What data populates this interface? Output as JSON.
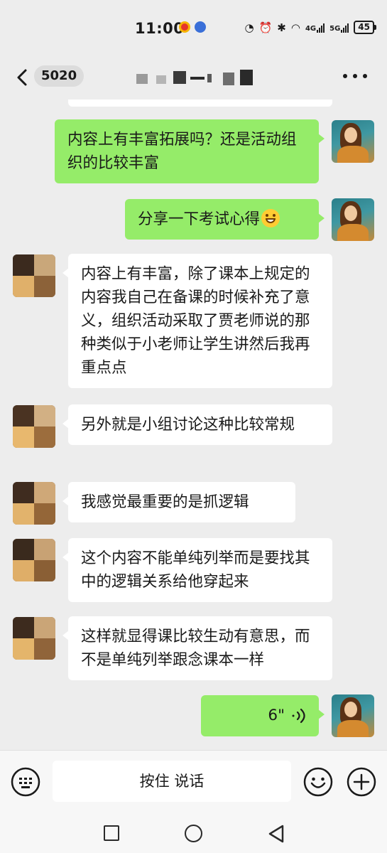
{
  "status_bar": {
    "time": "11:00",
    "network_1": "4G",
    "network_2": "5G",
    "battery": "45"
  },
  "header": {
    "unread_count": "5020"
  },
  "input_bar": {
    "voice_label": "按住 说话"
  },
  "colors": {
    "self_bubble": "#95ec69",
    "other_bubble": "#ffffff",
    "background": "#ededed"
  },
  "messages": [
    {
      "sender": "self",
      "text": "内容上有丰富拓展吗？还是活动组织的比较丰富"
    },
    {
      "sender": "self",
      "text": "分享一下考试心得",
      "emoji": "grin-emoji"
    },
    {
      "sender": "other",
      "text": "内容上有丰富，除了课本上规定的内容我自己在备课的时候补充了意义，组织活动采取了贾老师说的那种类似于小老师让学生讲然后我再重点点"
    },
    {
      "sender": "other",
      "text": "另外就是小组讨论这种比较常规"
    },
    {
      "sender": "other",
      "text": "我感觉最重要的是抓逻辑"
    },
    {
      "sender": "other",
      "text": "这个内容不能单纯列举而是要找其中的逻辑关系给他穿起来"
    },
    {
      "sender": "other",
      "text": "这样就显得课比较生动有意思，而不是单纯列举跟念课本一样"
    },
    {
      "sender": "self",
      "voice_duration": "6\""
    }
  ]
}
